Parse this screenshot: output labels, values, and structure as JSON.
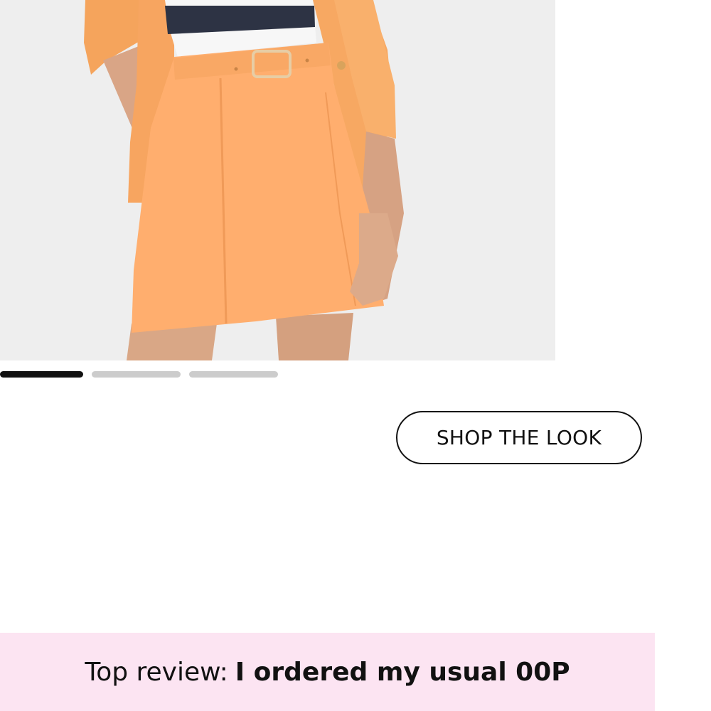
{
  "carousel": {
    "slide_count": 3,
    "active_index": 0
  },
  "shop_look": {
    "label": "SHOP THE LOOK"
  },
  "review": {
    "prefix": "Top review:",
    "headline": "I ordered my usual 00P"
  },
  "colors": {
    "skirt": "#ffae6e",
    "jacket": "#f9a862",
    "stripe_navy": "#2d3344",
    "banner_bg": "#fce4f2",
    "active_indicator": "#111111",
    "inactive_indicator": "#cccccc"
  }
}
